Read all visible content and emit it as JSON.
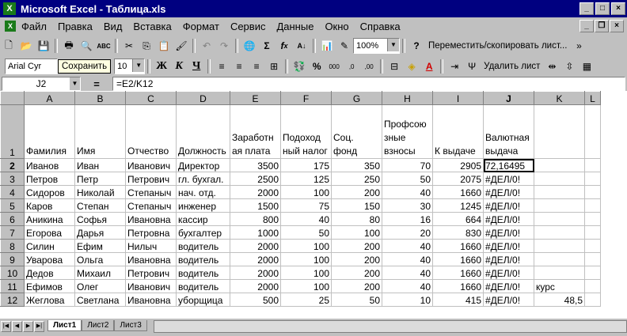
{
  "window": {
    "title": "Microsoft Excel - Таблица.xls",
    "app_icon": "excel-icon"
  },
  "menu": [
    "Файл",
    "Правка",
    "Вид",
    "Вставка",
    "Формат",
    "Сервис",
    "Данные",
    "Окно",
    "Справка"
  ],
  "toolbar1": {
    "zoom": "100%",
    "tip_text": "Переместить/скопировать лист..."
  },
  "toolbar2": {
    "font_name": "Arial Cyr",
    "tooltip": "Сохранить",
    "font_size": "10",
    "bold": "Ж",
    "italic": "К",
    "underline": "Ч",
    "delete_sheet": "Удалить лист"
  },
  "formula_bar": {
    "name_box": "J2",
    "eq": "=",
    "formula": "=E2/K12"
  },
  "columns": [
    "A",
    "B",
    "C",
    "D",
    "E",
    "F",
    "G",
    "H",
    "I",
    "J",
    "K",
    "L"
  ],
  "header_row": [
    "Фамилия",
    "Имя",
    "Отчество",
    "Должность",
    "Заработн ая плата",
    "Подоход ный налог",
    "Соц. фонд",
    "Профсою зные взносы",
    "К выдаче",
    "Валютная выдача",
    "",
    ""
  ],
  "rows": [
    [
      "Иванов",
      "Иван",
      "Иванович",
      "Директор",
      "3500",
      "175",
      "350",
      "70",
      "2905",
      "72,16495",
      "",
      ""
    ],
    [
      "Петров",
      "Петр",
      "Петрович",
      "гл. бухгал.",
      "2500",
      "125",
      "250",
      "50",
      "2075",
      "#ДЕЛ/0!",
      "",
      ""
    ],
    [
      "Сидоров",
      "Николай",
      "Степаныч",
      "нач. отд.",
      "2000",
      "100",
      "200",
      "40",
      "1660",
      "#ДЕЛ/0!",
      "",
      ""
    ],
    [
      "Каров",
      "Степан",
      "Степаныч",
      "инженер",
      "1500",
      "75",
      "150",
      "30",
      "1245",
      "#ДЕЛ/0!",
      "",
      ""
    ],
    [
      "Аникина",
      "Софья",
      "Ивановна",
      "кассир",
      "800",
      "40",
      "80",
      "16",
      "664",
      "#ДЕЛ/0!",
      "",
      ""
    ],
    [
      "Егорова",
      "Дарья",
      "Петровна",
      "бухгалтер",
      "1000",
      "50",
      "100",
      "20",
      "830",
      "#ДЕЛ/0!",
      "",
      ""
    ],
    [
      "Силин",
      "Ефим",
      "Нилыч",
      "водитель",
      "2000",
      "100",
      "200",
      "40",
      "1660",
      "#ДЕЛ/0!",
      "",
      ""
    ],
    [
      "Уварова",
      "Ольга",
      "Ивановна",
      "водитель",
      "2000",
      "100",
      "200",
      "40",
      "1660",
      "#ДЕЛ/0!",
      "",
      ""
    ],
    [
      "Дедов",
      "Михаил",
      "Петрович",
      "водитель",
      "2000",
      "100",
      "200",
      "40",
      "1660",
      "#ДЕЛ/0!",
      "",
      ""
    ],
    [
      "Ефимов",
      "Олег",
      "Иванович",
      "водитель",
      "2000",
      "100",
      "200",
      "40",
      "1660",
      "#ДЕЛ/0!",
      "курс",
      ""
    ],
    [
      "Жеглова",
      "Светлана",
      "Ивановна",
      "уборщица",
      "500",
      "25",
      "50",
      "10",
      "415",
      "#ДЕЛ/0!",
      "48,5",
      ""
    ]
  ],
  "sheets": [
    "Лист1",
    "Лист2",
    "Лист3"
  ],
  "active_sheet": "Лист1"
}
